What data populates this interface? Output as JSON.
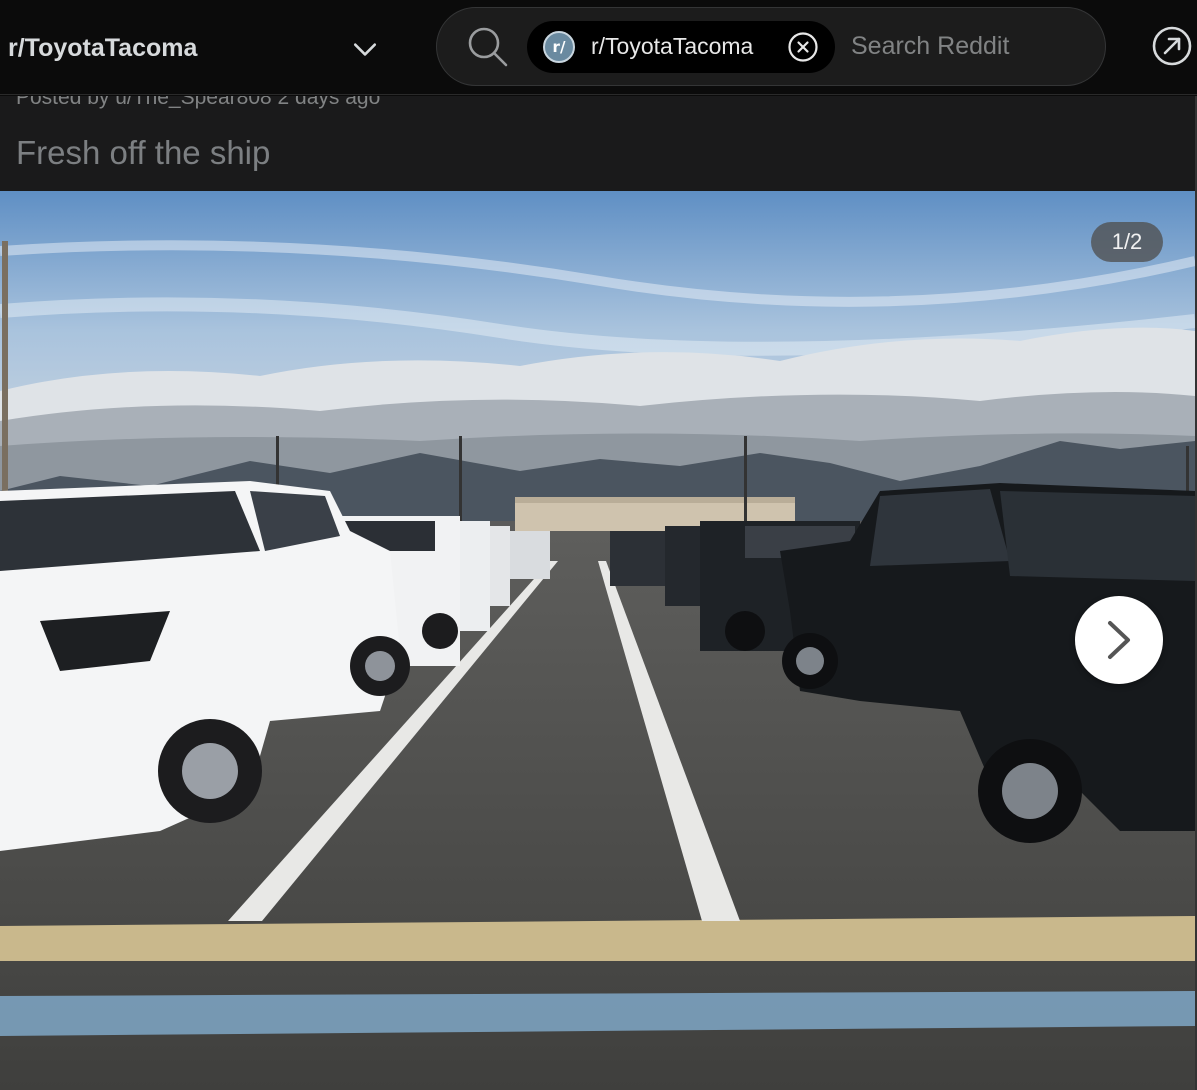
{
  "header": {
    "community_name": "r/ToyotaTacoma",
    "search": {
      "chip_avatar": "r/",
      "chip_label": "r/ToyotaTacoma",
      "placeholder": "Search Reddit"
    }
  },
  "post": {
    "posted_by": "Posted by u/The_Spear808 2 days ago",
    "title": "Fresh off the ship"
  },
  "gallery": {
    "counter": "1/2"
  },
  "icons": {
    "chevron": "chevron-down-icon",
    "search": "search-icon",
    "clear": "close-circle-icon",
    "open": "open-external-icon",
    "next": "chevron-right-icon"
  },
  "colors": {
    "background": "#0b0b0b",
    "post_header": "#1a1a1b",
    "text": "#d7dadc",
    "muted": "#818384"
  }
}
